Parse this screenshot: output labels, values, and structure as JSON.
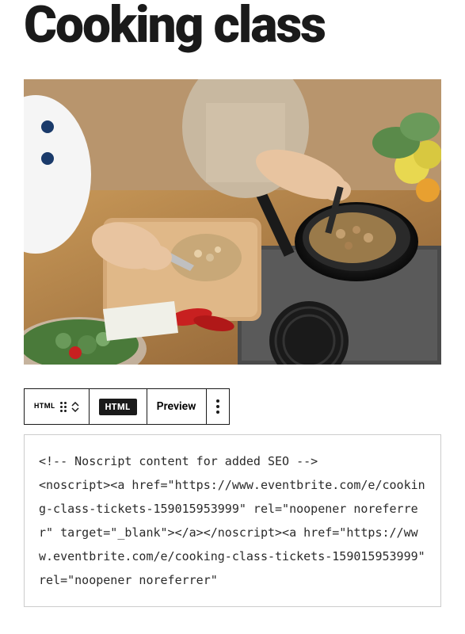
{
  "title": "Cooking class",
  "toolbar": {
    "html_small_label": "HTML",
    "html_badge": "HTML",
    "preview_label": "Preview"
  },
  "code": "<!-- Noscript content for added SEO -->\n<noscript><a href=\"https://www.eventbrite.com/e/cooking-class-tickets-159015953999\" rel=\"noopener noreferrer\" target=\"_blank\"></a></noscript><a href=\"https://www.eventbrite.com/e/cooking-class-tickets-159015953999\" rel=\"noopener noreferrer\""
}
